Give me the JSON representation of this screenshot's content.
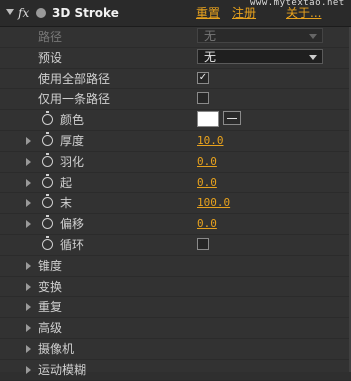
{
  "header": {
    "fx_label": "fx",
    "effect_name": "3D Stroke",
    "reset_label": "重置",
    "register_label": "注册",
    "about_label": "关于...",
    "watermark": "www.mytextao.net"
  },
  "rows": {
    "path": {
      "label": "路径",
      "value": "无"
    },
    "preset": {
      "label": "预设",
      "value": "无"
    },
    "use_all_paths": {
      "label": "使用全部路径",
      "checked": "✓"
    },
    "single_path": {
      "label": "仅用一条路径",
      "checked": ""
    },
    "color": {
      "label": "颜色",
      "color": "#ffffff"
    },
    "thickness": {
      "label": "厚度",
      "value": "10.0"
    },
    "feather": {
      "label": "羽化",
      "value": "0.0"
    },
    "start": {
      "label": "起",
      "value": "0.0"
    },
    "end": {
      "label": "末",
      "value": "100.0"
    },
    "offset": {
      "label": "偏移",
      "value": "0.0"
    },
    "loop": {
      "label": "循环",
      "checked": ""
    },
    "taper": {
      "label": "锥度"
    },
    "transform": {
      "label": "变换"
    },
    "repeater": {
      "label": "重复"
    },
    "advanced": {
      "label": "高级"
    },
    "camera": {
      "label": "摄像机"
    },
    "motion_blur": {
      "label": "运动模糊"
    }
  },
  "colors": {
    "accent": "#e8a21d",
    "panel": "#323232",
    "header": "#2a2a2a"
  },
  "icons": [
    "twisty-open-icon",
    "fx-icon",
    "effect-icon",
    "stopwatch-icon",
    "eyedropper-icon",
    "chevron-down-icon",
    "twisty-closed-icon"
  ]
}
